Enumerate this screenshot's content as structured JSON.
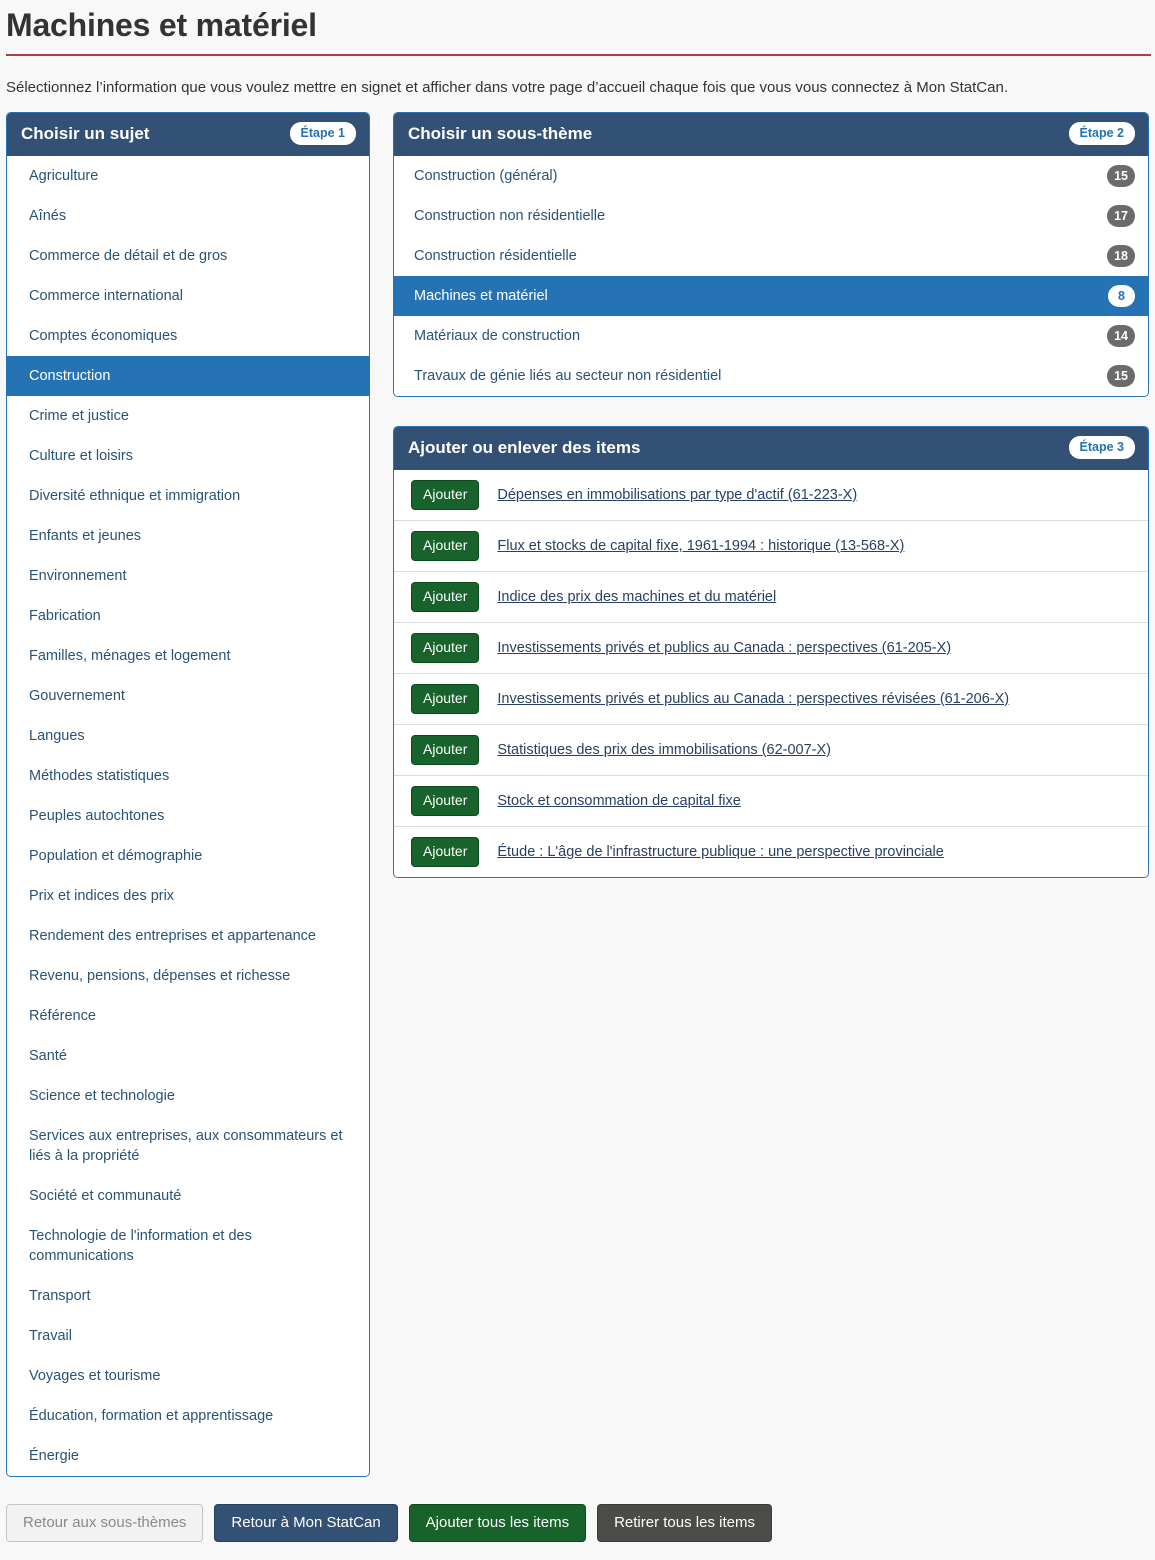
{
  "page": {
    "title": "Machines et matériel",
    "intro": "Sélectionnez l’information que vous voulez mettre en signet et afficher dans votre page d’accueil chaque fois que vous vous connectez à Mon StatCan.",
    "accent_rule_color": "#af3c43",
    "header_blue": "#335075",
    "selected_blue": "#2572b4",
    "link_color": "#284162",
    "add_button_green": "#17632b",
    "badge_gray": "#6b6b6b",
    "background": "#f8f8f8"
  },
  "subjects_panel": {
    "heading": "Choisir un sujet",
    "step_badge": "Étape 1",
    "items": [
      {
        "label": "Agriculture",
        "selected": false
      },
      {
        "label": "Aînés",
        "selected": false
      },
      {
        "label": "Commerce de détail et de gros",
        "selected": false
      },
      {
        "label": "Commerce international",
        "selected": false
      },
      {
        "label": "Comptes économiques",
        "selected": false
      },
      {
        "label": "Construction",
        "selected": true
      },
      {
        "label": "Crime et justice",
        "selected": false
      },
      {
        "label": "Culture et loisirs",
        "selected": false
      },
      {
        "label": "Diversité ethnique et immigration",
        "selected": false
      },
      {
        "label": "Enfants et jeunes",
        "selected": false
      },
      {
        "label": "Environnement",
        "selected": false
      },
      {
        "label": "Fabrication",
        "selected": false
      },
      {
        "label": "Familles, ménages et logement",
        "selected": false
      },
      {
        "label": "Gouvernement",
        "selected": false
      },
      {
        "label": "Langues",
        "selected": false
      },
      {
        "label": "Méthodes statistiques",
        "selected": false
      },
      {
        "label": "Peuples autochtones",
        "selected": false
      },
      {
        "label": "Population et démographie",
        "selected": false
      },
      {
        "label": "Prix et indices des prix",
        "selected": false
      },
      {
        "label": "Rendement des entreprises et appartenance",
        "selected": false
      },
      {
        "label": "Revenu, pensions, dépenses et richesse",
        "selected": false
      },
      {
        "label": "Référence",
        "selected": false
      },
      {
        "label": "Santé",
        "selected": false
      },
      {
        "label": "Science et technologie",
        "selected": false
      },
      {
        "label": "Services aux entreprises, aux consommateurs et liés à la propriété",
        "selected": false
      },
      {
        "label": "Société et communauté",
        "selected": false
      },
      {
        "label": "Technologie de l'information et des communications",
        "selected": false
      },
      {
        "label": "Transport",
        "selected": false
      },
      {
        "label": "Travail",
        "selected": false
      },
      {
        "label": "Voyages et tourisme",
        "selected": false
      },
      {
        "label": "Éducation, formation et apprentissage",
        "selected": false
      },
      {
        "label": "Énergie",
        "selected": false
      }
    ]
  },
  "subthemes_panel": {
    "heading": "Choisir un sous-thème",
    "step_badge": "Étape 2",
    "items": [
      {
        "label": "Construction (général)",
        "count": "15",
        "selected": false
      },
      {
        "label": "Construction non résidentielle",
        "count": "17",
        "selected": false
      },
      {
        "label": "Construction résidentielle",
        "count": "18",
        "selected": false
      },
      {
        "label": "Machines et matériel",
        "count": "8",
        "selected": true
      },
      {
        "label": "Matériaux de construction",
        "count": "14",
        "selected": false
      },
      {
        "label": "Travaux de génie liés au secteur non résidentiel",
        "count": "15",
        "selected": false
      }
    ]
  },
  "items_panel": {
    "heading": "Ajouter ou enlever des items",
    "step_badge": "Étape 3",
    "add_label": "Ajouter",
    "items": [
      {
        "add_label": "Ajouter",
        "title": "Dépenses en immobilisations par type d'actif (61-223-X)"
      },
      {
        "add_label": "Ajouter",
        "title": "Flux et stocks de capital fixe, 1961-1994 : historique (13-568-X)"
      },
      {
        "add_label": "Ajouter",
        "title": "Indice des prix des machines et du matériel"
      },
      {
        "add_label": "Ajouter",
        "title": "Investissements privés et publics au Canada : perspectives (61-205-X)"
      },
      {
        "add_label": "Ajouter",
        "title": "Investissements privés et publics au Canada : perspectives révisées (61-206-X)"
      },
      {
        "add_label": "Ajouter",
        "title": "Statistiques des prix des immobilisations (62-007-X)"
      },
      {
        "add_label": "Ajouter",
        "title": "Stock et consommation de capital fixe"
      },
      {
        "add_label": "Ajouter",
        "title": "Étude : L'âge de l'infrastructure publique : une perspective provinciale"
      }
    ]
  },
  "footer": {
    "back_to_subthemes": "Retour aux sous-thèmes",
    "back_to_mystatcan": "Retour à Mon StatCan",
    "add_all": "Ajouter tous les items",
    "remove_all": "Retirer tous les items"
  }
}
